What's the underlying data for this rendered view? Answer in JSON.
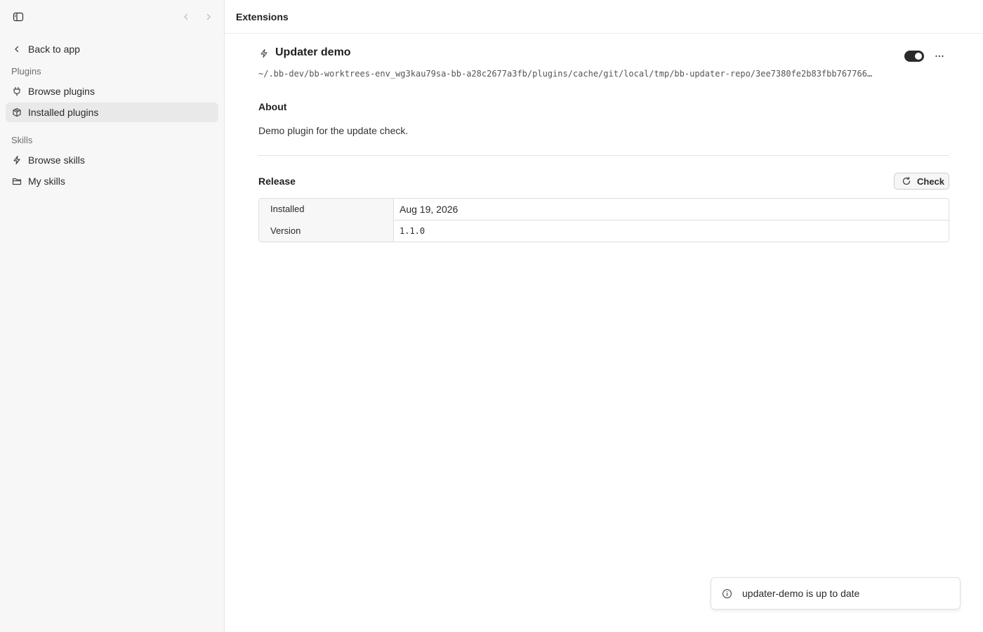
{
  "sidebar": {
    "toggle_icon": "sidebar-toggle-icon",
    "back_icon": "chevron-left-icon",
    "forward_icon": "chevron-right-icon",
    "back_link": "Back to app",
    "plugins_section": "Plugins",
    "skills_section": "Skills",
    "items": [
      {
        "label": "Browse plugins",
        "icon": "plug-icon",
        "active": false
      },
      {
        "label": "Installed plugins",
        "icon": "package-icon",
        "active": true
      },
      {
        "label": "Browse skills",
        "icon": "bolt-icon",
        "active": false
      },
      {
        "label": "My skills",
        "icon": "folder-icon",
        "active": false
      }
    ]
  },
  "header": {
    "title": "Extensions"
  },
  "plugin": {
    "name": "Updater demo",
    "icon": "bolt-icon",
    "enabled": true,
    "path": "~/.bb-dev/bb-worktrees-env_wg3kau79sa-bb-a28c2677a3fb/plugins/cache/git/local/tmp/bb-updater-repo/3ee7380fe2b83fbb767766…",
    "about_title": "About",
    "description": "Demo plugin for the update check."
  },
  "release": {
    "title": "Release",
    "check_label": "Check",
    "rows": [
      {
        "key": "Installed",
        "value": "Aug 19, 2026"
      },
      {
        "key": "Version",
        "value": "1.1.0"
      }
    ]
  },
  "toast": {
    "icon": "info-icon",
    "message": "updater-demo is up to date"
  },
  "colors": {
    "sidebar_bg": "#f7f7f7",
    "active_item_bg": "#e9e9e9",
    "toggle_on": "#2b2b2b"
  }
}
